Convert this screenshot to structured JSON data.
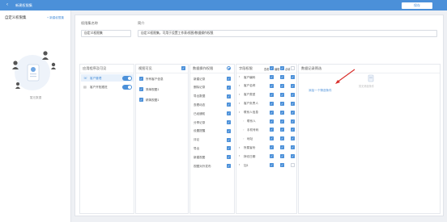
{
  "header": {
    "back_icon": "back-arrow-icon",
    "title": "新建权限集",
    "save_label": "保存"
  },
  "sidebar": {
    "title": "自定义权限集",
    "new_link": "+ 新建权限集",
    "empty_text": "暂无数据"
  },
  "form": {
    "name_label": "权限集名称",
    "name_value": "自定义权限集",
    "desc_label": "简介",
    "desc_value": "自定义权限集，可用于设置工作表/视图/数据操作权限"
  },
  "apps": {
    "header": "应用程序及可见",
    "items": [
      {
        "label": "客户管理",
        "selected": true,
        "enabled": true
      },
      {
        "label": "客户开拓跟进",
        "selected": false,
        "enabled": true
      }
    ]
  },
  "views": {
    "header": "视图可见",
    "items": [
      {
        "label": "所有客户信息"
      },
      {
        "label": "简单视图1"
      },
      {
        "label": "精简视图1"
      }
    ]
  },
  "ops": {
    "header": "数据操作权限",
    "items": [
      "新建记录",
      "删除记录",
      "导出数据",
      "查看动态",
      "已经通知",
      "分享记录",
      "设置提醒",
      "评论",
      "导出",
      "新建视图",
      "视图对外发布"
    ]
  },
  "fields": {
    "header": "字段权限",
    "col_view": "查看",
    "col_edit": "编辑",
    "col_req": "必填",
    "items": [
      "客户编码",
      "客户名称",
      "客户类型",
      "客户负责人",
      "联系人信息",
      "联系人",
      "手机号码",
      "地址",
      "所属省份",
      "拜访日期",
      "加1"
    ]
  },
  "records": {
    "header": "数据记录筛选",
    "add_text": "添加一个筛选条件",
    "hint_text": "暂无筛选条件"
  },
  "colors": {
    "accent": "#4b90d9",
    "arrow": "#d9302c"
  }
}
